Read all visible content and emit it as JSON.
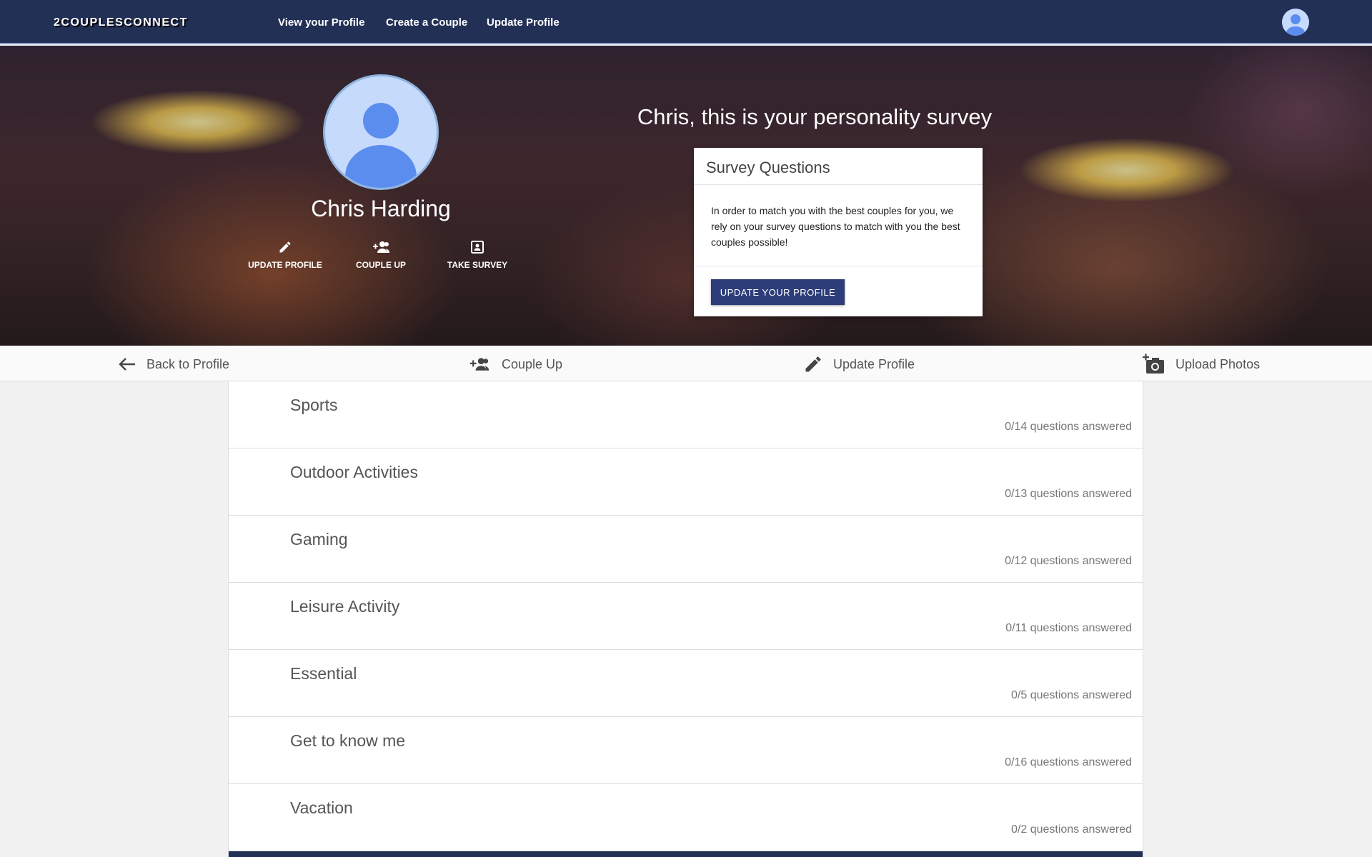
{
  "navbar": {
    "brand": "2COUPLESCONNECT",
    "links": [
      "View your Profile",
      "Create a Couple",
      "Update Profile"
    ],
    "avatar_icon": "account-circle-icon"
  },
  "profile": {
    "name": "Chris Harding",
    "actions": [
      {
        "label": "UPDATE PROFILE",
        "icon": "pencil-icon"
      },
      {
        "label": "COUPLE UP",
        "icon": "group-add-icon"
      },
      {
        "label": "TAKE SURVEY",
        "icon": "contact-card-icon"
      }
    ]
  },
  "survey": {
    "heading": "Chris, this is your personality survey",
    "card_title": "Survey Questions",
    "card_body": "In order to match you with the best couples for you, we rely on your survey questions to match with you the best couples possible!",
    "card_button": "UPDATE YOUR PROFILE"
  },
  "subnav": [
    {
      "label": "Back to Profile",
      "icon": "arrow-left-icon"
    },
    {
      "label": "Couple Up",
      "icon": "group-add-icon"
    },
    {
      "label": "Update Profile",
      "icon": "pencil-icon"
    },
    {
      "label": "Upload Photos",
      "icon": "add-camera-icon"
    }
  ],
  "categories": [
    {
      "name": "Sports",
      "progress": "0/14 questions answered"
    },
    {
      "name": "Outdoor Activities",
      "progress": "0/13 questions answered"
    },
    {
      "name": "Gaming",
      "progress": "0/12 questions answered"
    },
    {
      "name": "Leisure Activity",
      "progress": "0/11 questions answered"
    },
    {
      "name": "Essential",
      "progress": "0/5 questions answered"
    },
    {
      "name": "Get to know me",
      "progress": "0/16 questions answered"
    },
    {
      "name": "Vacation",
      "progress": "0/2 questions answered"
    }
  ],
  "colors": {
    "navbar": "#233056",
    "button": "#2d3d7a",
    "avatar_bg": "#c6dafc",
    "avatar_fg": "#5b8def"
  }
}
